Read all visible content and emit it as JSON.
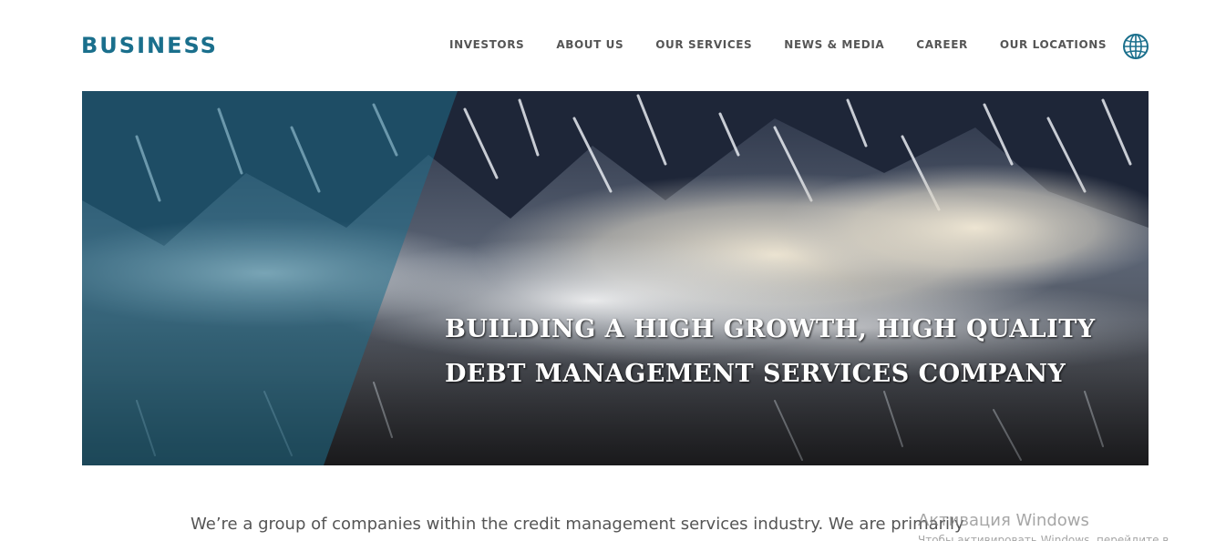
{
  "brand": {
    "logo": "BUSINESS",
    "color": "#1a6f8c"
  },
  "nav": {
    "items": [
      {
        "label": "INVESTORS"
      },
      {
        "label": "ABOUT US"
      },
      {
        "label": "OUR SERVICES"
      },
      {
        "label": "NEWS & MEDIA"
      },
      {
        "label": "CAREER"
      },
      {
        "label": "OUR LOCATIONS"
      }
    ],
    "language_icon": "globe-icon"
  },
  "hero": {
    "title_line1": "BUILDING A HIGH GROWTH, HIGH QUALITY",
    "title_line2": "DEBT MANAGEMENT SERVICES COMPANY",
    "overlay_color": "#1f6e8a"
  },
  "intro": {
    "text": "We’re a group of companies within the credit management services industry. We are primarily"
  },
  "watermark": {
    "title": "Активация Windows",
    "subtitle": "Чтобы активировать Windows, перейдите в"
  }
}
